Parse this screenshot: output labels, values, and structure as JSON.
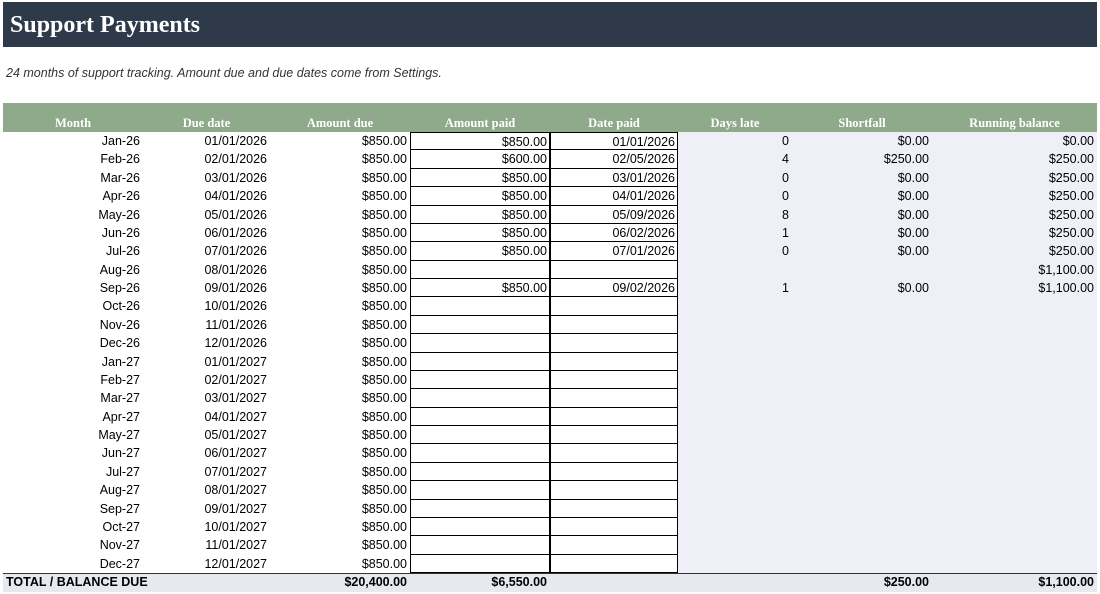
{
  "title": "Support Payments",
  "subtitle": "24 months of support tracking. Amount due and due dates come from Settings.",
  "columns": [
    "Month",
    "Due date",
    "Amount due",
    "Amount paid",
    "Date paid",
    "Days late",
    "Shortfall",
    "Running balance"
  ],
  "rows": [
    {
      "month": "Jan-26",
      "due_date": "01/01/2026",
      "amount_due": "$850.00",
      "amount_paid": "$850.00",
      "date_paid": "01/01/2026",
      "days_late": "0",
      "shortfall": "$0.00",
      "running_balance": "$0.00"
    },
    {
      "month": "Feb-26",
      "due_date": "02/01/2026",
      "amount_due": "$850.00",
      "amount_paid": "$600.00",
      "date_paid": "02/05/2026",
      "days_late": "4",
      "shortfall": "$250.00",
      "running_balance": "$250.00"
    },
    {
      "month": "Mar-26",
      "due_date": "03/01/2026",
      "amount_due": "$850.00",
      "amount_paid": "$850.00",
      "date_paid": "03/01/2026",
      "days_late": "0",
      "shortfall": "$0.00",
      "running_balance": "$250.00"
    },
    {
      "month": "Apr-26",
      "due_date": "04/01/2026",
      "amount_due": "$850.00",
      "amount_paid": "$850.00",
      "date_paid": "04/01/2026",
      "days_late": "0",
      "shortfall": "$0.00",
      "running_balance": "$250.00"
    },
    {
      "month": "May-26",
      "due_date": "05/01/2026",
      "amount_due": "$850.00",
      "amount_paid": "$850.00",
      "date_paid": "05/09/2026",
      "days_late": "8",
      "shortfall": "$0.00",
      "running_balance": "$250.00"
    },
    {
      "month": "Jun-26",
      "due_date": "06/01/2026",
      "amount_due": "$850.00",
      "amount_paid": "$850.00",
      "date_paid": "06/02/2026",
      "days_late": "1",
      "shortfall": "$0.00",
      "running_balance": "$250.00"
    },
    {
      "month": "Jul-26",
      "due_date": "07/01/2026",
      "amount_due": "$850.00",
      "amount_paid": "$850.00",
      "date_paid": "07/01/2026",
      "days_late": "0",
      "shortfall": "$0.00",
      "running_balance": "$250.00"
    },
    {
      "month": "Aug-26",
      "due_date": "08/01/2026",
      "amount_due": "$850.00",
      "amount_paid": "",
      "date_paid": "",
      "days_late": "",
      "shortfall": "",
      "running_balance": "$1,100.00"
    },
    {
      "month": "Sep-26",
      "due_date": "09/01/2026",
      "amount_due": "$850.00",
      "amount_paid": "$850.00",
      "date_paid": "09/02/2026",
      "days_late": "1",
      "shortfall": "$0.00",
      "running_balance": "$1,100.00"
    },
    {
      "month": "Oct-26",
      "due_date": "10/01/2026",
      "amount_due": "$850.00",
      "amount_paid": "",
      "date_paid": "",
      "days_late": "",
      "shortfall": "",
      "running_balance": ""
    },
    {
      "month": "Nov-26",
      "due_date": "11/01/2026",
      "amount_due": "$850.00",
      "amount_paid": "",
      "date_paid": "",
      "days_late": "",
      "shortfall": "",
      "running_balance": ""
    },
    {
      "month": "Dec-26",
      "due_date": "12/01/2026",
      "amount_due": "$850.00",
      "amount_paid": "",
      "date_paid": "",
      "days_late": "",
      "shortfall": "",
      "running_balance": ""
    },
    {
      "month": "Jan-27",
      "due_date": "01/01/2027",
      "amount_due": "$850.00",
      "amount_paid": "",
      "date_paid": "",
      "days_late": "",
      "shortfall": "",
      "running_balance": ""
    },
    {
      "month": "Feb-27",
      "due_date": "02/01/2027",
      "amount_due": "$850.00",
      "amount_paid": "",
      "date_paid": "",
      "days_late": "",
      "shortfall": "",
      "running_balance": ""
    },
    {
      "month": "Mar-27",
      "due_date": "03/01/2027",
      "amount_due": "$850.00",
      "amount_paid": "",
      "date_paid": "",
      "days_late": "",
      "shortfall": "",
      "running_balance": ""
    },
    {
      "month": "Apr-27",
      "due_date": "04/01/2027",
      "amount_due": "$850.00",
      "amount_paid": "",
      "date_paid": "",
      "days_late": "",
      "shortfall": "",
      "running_balance": ""
    },
    {
      "month": "May-27",
      "due_date": "05/01/2027",
      "amount_due": "$850.00",
      "amount_paid": "",
      "date_paid": "",
      "days_late": "",
      "shortfall": "",
      "running_balance": ""
    },
    {
      "month": "Jun-27",
      "due_date": "06/01/2027",
      "amount_due": "$850.00",
      "amount_paid": "",
      "date_paid": "",
      "days_late": "",
      "shortfall": "",
      "running_balance": ""
    },
    {
      "month": "Jul-27",
      "due_date": "07/01/2027",
      "amount_due": "$850.00",
      "amount_paid": "",
      "date_paid": "",
      "days_late": "",
      "shortfall": "",
      "running_balance": ""
    },
    {
      "month": "Aug-27",
      "due_date": "08/01/2027",
      "amount_due": "$850.00",
      "amount_paid": "",
      "date_paid": "",
      "days_late": "",
      "shortfall": "",
      "running_balance": ""
    },
    {
      "month": "Sep-27",
      "due_date": "09/01/2027",
      "amount_due": "$850.00",
      "amount_paid": "",
      "date_paid": "",
      "days_late": "",
      "shortfall": "",
      "running_balance": ""
    },
    {
      "month": "Oct-27",
      "due_date": "10/01/2027",
      "amount_due": "$850.00",
      "amount_paid": "",
      "date_paid": "",
      "days_late": "",
      "shortfall": "",
      "running_balance": ""
    },
    {
      "month": "Nov-27",
      "due_date": "11/01/2027",
      "amount_due": "$850.00",
      "amount_paid": "",
      "date_paid": "",
      "days_late": "",
      "shortfall": "",
      "running_balance": ""
    },
    {
      "month": "Dec-27",
      "due_date": "12/01/2027",
      "amount_due": "$850.00",
      "amount_paid": "",
      "date_paid": "",
      "days_late": "",
      "shortfall": "",
      "running_balance": ""
    }
  ],
  "totals": {
    "label": "TOTAL / BALANCE DUE",
    "amount_due": "$20,400.00",
    "amount_paid": "$6,550.00",
    "shortfall": "$250.00",
    "running_balance": "$1,100.00"
  },
  "colors": {
    "title_bar": "#2e3a4a",
    "header_band": "#8fa98b",
    "computed_area": "#eeeff7",
    "total_band": "#e6e9ef"
  }
}
